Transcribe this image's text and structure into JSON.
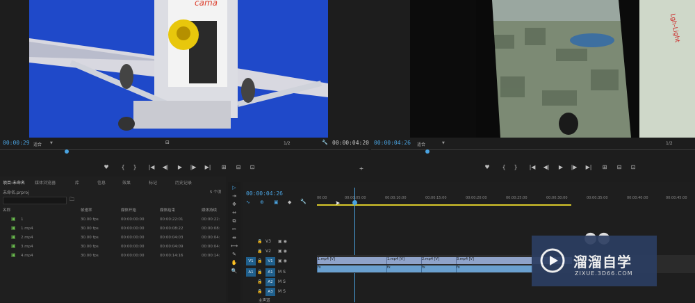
{
  "source_monitor": {
    "timecode_left": "00:00:29",
    "timecode_right": "00:00:04:20",
    "fit_label": "适合",
    "quality_label": "1/2",
    "banner_text": "cama"
  },
  "program_monitor": {
    "timecode_left": "00:00:04:26",
    "fit_label": "适合",
    "quality_label": "1/2",
    "banner_text": "Lgh-Light"
  },
  "transport_icons": [
    "♥",
    "{",
    "}",
    "|◀",
    "◀|",
    "▶",
    "|▶",
    "▶|",
    "⊞",
    "⊟",
    "⊡"
  ],
  "project_panel": {
    "tabs": [
      "项目:未命名",
      "媒体浏览器",
      "库",
      "信息",
      "效果",
      "标记",
      "历史记录"
    ],
    "project_name": "未命名.prproj",
    "item_count": "5 个项",
    "columns": [
      "名称",
      "帧速率",
      "媒体开始",
      "媒体结束",
      "媒体持续"
    ],
    "rows": [
      {
        "name": "1",
        "fps": "30.00 fps",
        "start": "00:00:00:00",
        "end": "00:00:22:01",
        "dur": "00:00:22:"
      },
      {
        "name": "1.mp4",
        "fps": "30.00 fps",
        "start": "00:00:00:00",
        "end": "00:00:08:22",
        "dur": "00:00:08:"
      },
      {
        "name": "2.mp4",
        "fps": "30.00 fps",
        "start": "00:00:00:00",
        "end": "00:00:04:03",
        "dur": "00:00:04:"
      },
      {
        "name": "3.mp4",
        "fps": "30.00 fps",
        "start": "00:00:00:00",
        "end": "00:00:04:09",
        "dur": "00:00:04:"
      },
      {
        "name": "4.mp4",
        "fps": "30.00 fps",
        "start": "00:00:00:00",
        "end": "00:00:14:16",
        "dur": "00:00:14:"
      }
    ]
  },
  "timeline": {
    "timecode": "00:00:04:26",
    "ruler": [
      "00:00",
      "00:00:05:00",
      "00:00:10:00",
      "00:00:15:00",
      "00:00:20:00",
      "00:00:25:00",
      "00:00:30:00",
      "00:00:35:00",
      "00:00:40:00",
      "00:00:45:00"
    ],
    "video_tracks": [
      "V3",
      "V2",
      "V1"
    ],
    "audio_tracks": [
      "A1",
      "A2",
      "A3"
    ],
    "source_patch_v": "V1",
    "source_patch_a": "A1",
    "master_label": "主声道",
    "video_clips": [
      "1.mp4 [V]",
      "1.mp4 [V]",
      "2.mp4 [V]",
      "3.mp4 [V]"
    ],
    "audio_clips": [
      "fx",
      "fx",
      "fx",
      "fx"
    ]
  },
  "watermark": {
    "cn": "溜溜自学",
    "url": "ZIXUE.3D66.COM"
  },
  "colors": {
    "accent": "#4aa3e0",
    "work_area": "#d9c92a",
    "track_toggle": "#1f5f8c",
    "video_clip": "#8fa3c9",
    "audio_clip": "#6aa0cf",
    "watermark_bg": "#2c3e62"
  }
}
